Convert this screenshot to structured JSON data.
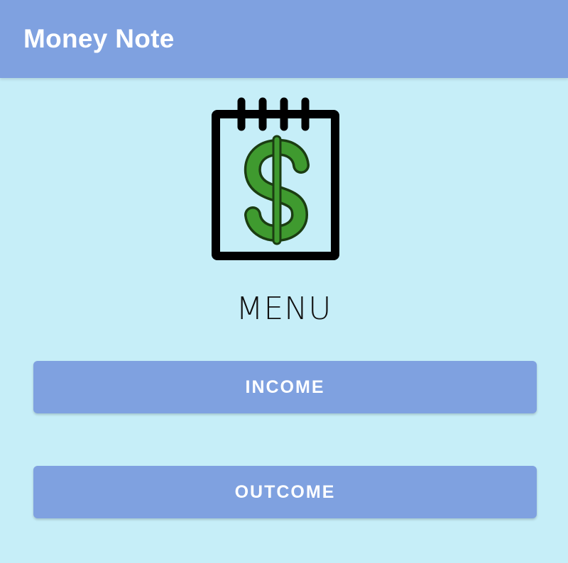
{
  "app_bar": {
    "title": "Money Note"
  },
  "logo": {
    "icon": "notepad-dollar-icon",
    "symbol": "$",
    "colors": {
      "frame": "#000000",
      "dollar": "#3f9a2f"
    }
  },
  "main": {
    "heading": "MENU",
    "buttons": [
      {
        "label": "INCOME"
      },
      {
        "label": "OUTCOME"
      }
    ]
  },
  "colors": {
    "background": "#c6eef8",
    "accent": "#7fa1e0",
    "button_text": "#ffffff"
  }
}
